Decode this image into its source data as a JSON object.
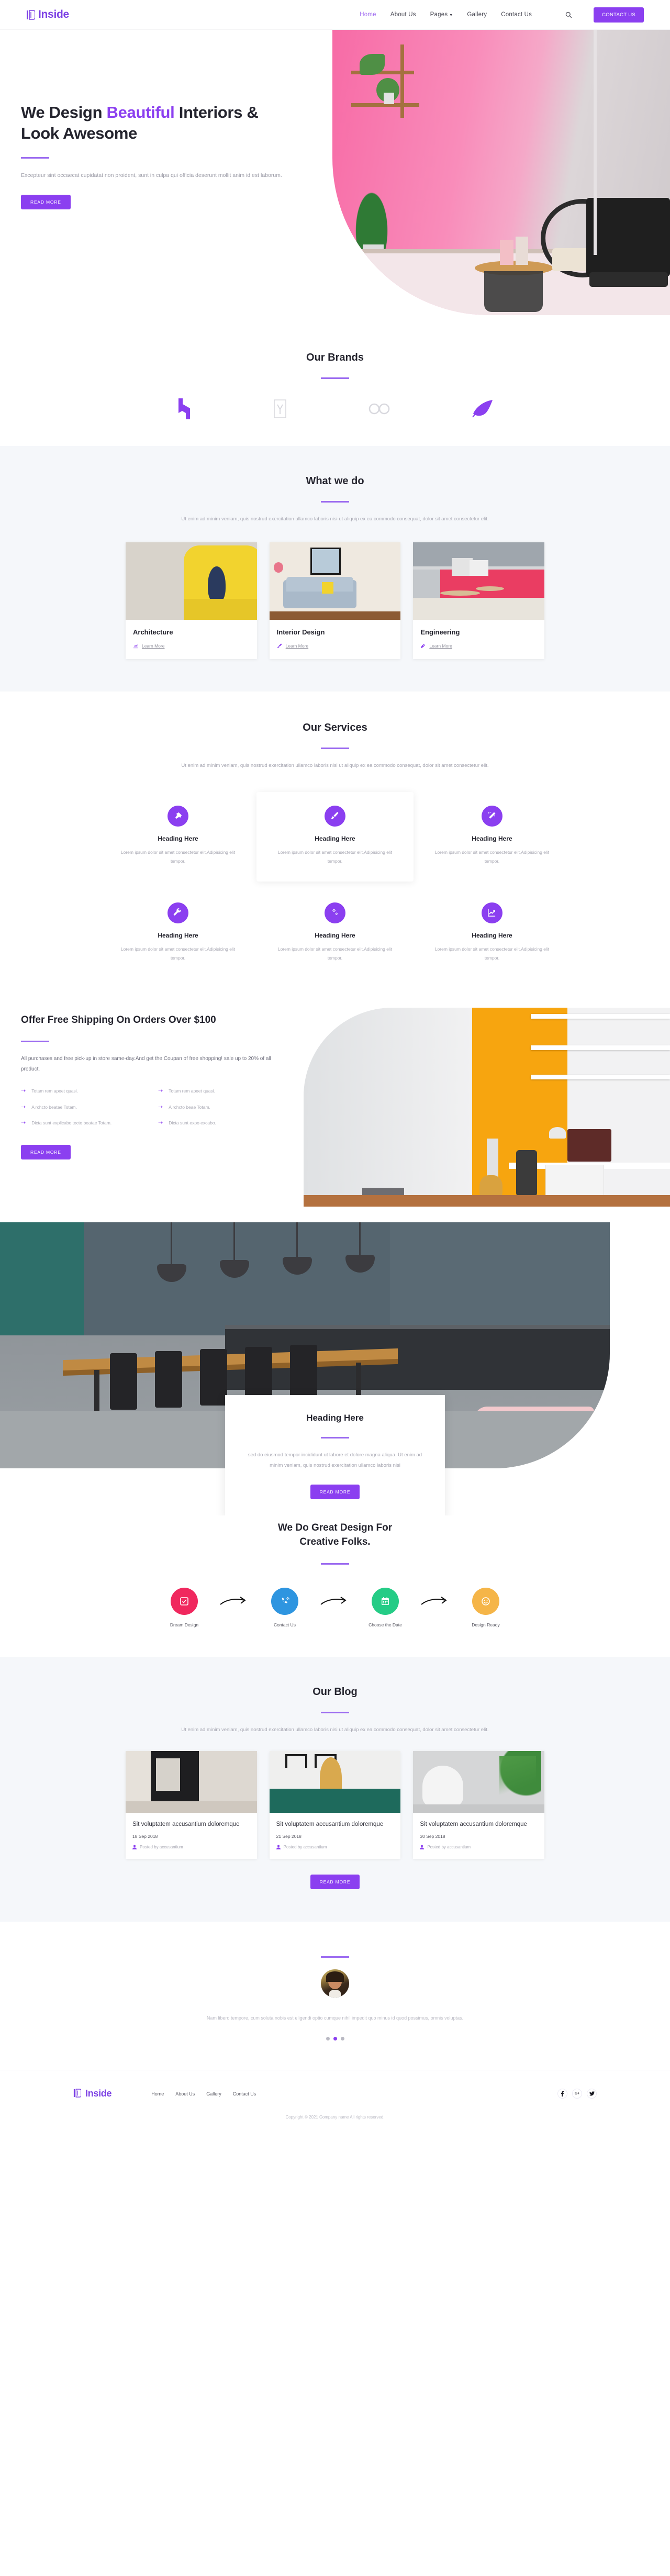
{
  "brand": {
    "name": "Inside",
    "color": "#7b3fe4",
    "logo_icon": "inside-logo-icon"
  },
  "header": {
    "nav": [
      {
        "label": "Home",
        "active": true
      },
      {
        "label": "About Us",
        "active": false
      },
      {
        "label": "Pages",
        "active": false,
        "has_dropdown": true
      },
      {
        "label": "Gallery",
        "active": false
      },
      {
        "label": "Contact Us",
        "active": false
      }
    ],
    "search_icon": "search-icon",
    "cta_label": "CONTACT US"
  },
  "hero": {
    "title_part1": "We Design ",
    "title_accent": "Beautiful",
    "title_part2": " Interiors &",
    "title_line2": "Look Awesome",
    "paragraph": "Excepteur sint occaecat cupidatat non proident, sunt in culpa qui officia deserunt mollit anim id est laborum.",
    "button": "READ MORE",
    "image_alt": "pink-interior-room-photo"
  },
  "brands": {
    "title": "Our Brands",
    "items": [
      {
        "name": "houzz-logo",
        "color": "#8b3ff0"
      },
      {
        "name": "yelp-logo",
        "color": "#d8d8de"
      },
      {
        "name": "infinity-logo",
        "color": "#d8d8de"
      },
      {
        "name": "feather-logo",
        "color": "#8b3ff0"
      }
    ]
  },
  "what_we_do": {
    "title": "What we do",
    "subtitle": "Ut enim ad minim veniam, quis nostrud exercitation ullamco laboris nisi ut aliquip ex ea commodo consequat, dolor sit amet consectetur elit.",
    "cards": [
      {
        "title": "Architecture",
        "link": "Learn More",
        "icon": "chart-line-icon",
        "image_alt": "yellow-armchair-photo"
      },
      {
        "title": "Interior Design",
        "link": "Learn More",
        "icon": "paint-brush-icon",
        "image_alt": "grey-sofa-living-room-photo"
      },
      {
        "title": "Engineering",
        "link": "Learn More",
        "icon": "tools-icon",
        "image_alt": "pink-sofa-side-table-photo"
      }
    ]
  },
  "services": {
    "title": "Our Services",
    "subtitle": "Ut enim ad minim veniam, quis nostrud exercitation ullamco laboris nisi ut aliquip ex ea commodo consequat, dolor sit amet consectetur elit.",
    "items": [
      {
        "heading": "Heading Here",
        "text": "Lorem ipsum dolor sit amet consectetur elit,Adipisicing elit tempor.",
        "icon": "hammer-icon",
        "raised": false
      },
      {
        "heading": "Heading Here",
        "text": "Lorem ipsum dolor sit amet consectetur elit,Adipisicing elit tempor.",
        "icon": "paint-brush-icon",
        "raised": true
      },
      {
        "heading": "Heading Here",
        "text": "Lorem ipsum dolor sit amet consectetur elit,Adipisicing elit tempor.",
        "icon": "magic-wand-icon",
        "raised": false
      },
      {
        "heading": "Heading Here",
        "text": "Lorem ipsum dolor sit amet consectetur elit,Adipisicing elit tempor.",
        "icon": "wrench-icon",
        "raised": false
      },
      {
        "heading": "Heading Here",
        "text": "Lorem ipsum dolor sit amet consectetur elit,Adipisicing elit tempor.",
        "icon": "gears-icon",
        "raised": false
      },
      {
        "heading": "Heading Here",
        "text": "Lorem ipsum dolor sit amet consectetur elit,Adipisicing elit tempor.",
        "icon": "chart-line-icon",
        "raised": false
      }
    ]
  },
  "offer": {
    "title": "Offer Free Shipping On Orders Over $100",
    "description": "All purchases and free pick-up in store same-day.And get the Coupan of free shopping! sale up to 20% of all product.",
    "list_left": [
      "Totam rem apeet quasi.",
      "A rchcto beatae Totam.",
      "Dicta sunt explicabo tecto beatae Totam."
    ],
    "list_right": [
      "Totam rem apeet quasi.",
      "A rchcto beae Totam.",
      "Dicta sunt expo excabo."
    ],
    "button": "READ MORE",
    "image_alt": "orange-wall-home-office-photo"
  },
  "feature": {
    "image_alt": "dark-kitchen-long-table-photo",
    "card_title": "Heading Here",
    "card_text": "sed do eiusmod tempor incididunt ut labore et dolore magna aliqua. Ut enim ad minim veniam, quis nostrud exercitation ullamco laboris nisi",
    "card_button": "READ MORE"
  },
  "process": {
    "title_line1": "We Do Great Design For",
    "title_line2": "Creative Folks.",
    "steps": [
      {
        "label": "Dream Design",
        "color": "#f0285e",
        "icon": "check-square-icon"
      },
      {
        "label": "Contact Us",
        "color": "#2e95e0",
        "icon": "phone-volume-icon"
      },
      {
        "label": "Choose the Date",
        "color": "#25cc86",
        "icon": "calendar-icon"
      },
      {
        "label": "Design Ready",
        "color": "#f5b548",
        "icon": "smile-icon"
      }
    ],
    "arrow_icon": "curved-arrow-icon"
  },
  "blog": {
    "title": "Our Blog",
    "subtitle": "Ut enim ad minim veniam, quis nostrud exercitation ullamco laboris nisi ut aliquip ex ea commodo consequat, dolor sit amet consectetur elit.",
    "posts": [
      {
        "title": "Sit voluptatem accusantium doloremque",
        "date": "18 Sep 2018",
        "author": "Posted by accusantium",
        "icon": "user-icon",
        "image_alt": "dark-fireplace-interior-photo"
      },
      {
        "title": "Sit voluptatem accusantium doloremque",
        "date": "21 Sep 2018",
        "author": "Posted by accusantium",
        "icon": "user-icon",
        "image_alt": "green-table-dried-pampas-photo"
      },
      {
        "title": "Sit voluptatem accusantium doloremque",
        "date": "30 Sep 2018",
        "author": "Posted by accusantium",
        "icon": "user-icon",
        "image_alt": "white-chair-plant-photo"
      }
    ],
    "button": "READ MORE"
  },
  "testimonial": {
    "avatar_alt": "smiling-woman-portrait",
    "quote": "Nam libero tempore, cum soluta nobis est eligendi optio cumque nihil impedit quo minus id quod possimus, omnis voluptas.",
    "dots": [
      {
        "active": false
      },
      {
        "active": true
      },
      {
        "active": false
      }
    ]
  },
  "footer": {
    "brand": "Inside",
    "nav": [
      {
        "label": "Home"
      },
      {
        "label": "About Us"
      },
      {
        "label": "Gallery"
      },
      {
        "label": "Contact Us"
      }
    ],
    "socials": [
      {
        "name": "facebook-icon",
        "glyph": "f"
      },
      {
        "name": "google-plus-icon",
        "glyph": "G+"
      },
      {
        "name": "twitter-icon",
        "glyph": "✉"
      }
    ],
    "copyright": "Copyright © 2021 Company name All rights reserved."
  },
  "colors": {
    "accent": "#8b3ff0",
    "accent_light": "#9b6bf0",
    "bg_gray": "#f5f7fa",
    "text_dark": "#24242e",
    "text_muted": "#a6a6b1"
  }
}
